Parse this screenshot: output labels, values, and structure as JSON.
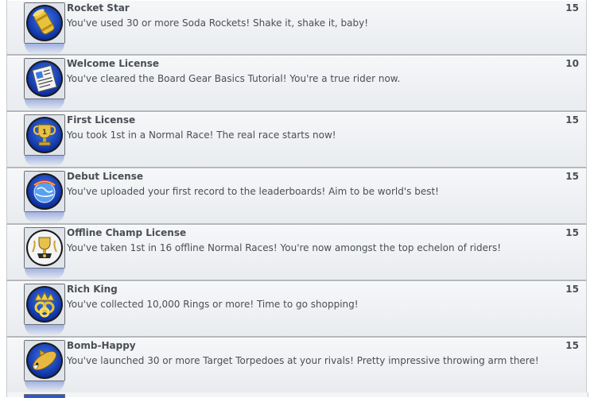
{
  "achievements": [
    {
      "title": "Rocket Star",
      "description": "You've used 30 or more Soda Rockets! Shake it, shake it, baby!",
      "points": "15",
      "icon": "soda-rocket-icon"
    },
    {
      "title": "Welcome License",
      "description": "You've cleared the Board Gear Basics Tutorial! You're a true rider now.",
      "points": "10",
      "icon": "license-document-icon"
    },
    {
      "title": "First License",
      "description": "You took 1st in a Normal Race! The real race starts now!",
      "points": "15",
      "icon": "trophy-icon"
    },
    {
      "title": "Debut License",
      "description": "You've uploaded your first record to the leaderboards! Aim to be world's best!",
      "points": "15",
      "icon": "globe-icon"
    },
    {
      "title": "Offline Champ License",
      "description": "You've taken 1st in 16 offline Normal Races! You're now amongst the top echelon of riders!",
      "points": "15",
      "icon": "champion-trophy-icon"
    },
    {
      "title": "Rich King",
      "description": "You've collected 10,000 Rings or more! Time to go shopping!",
      "points": "15",
      "icon": "crown-rings-icon"
    },
    {
      "title": "Bomb-Happy",
      "description": "You've launched 30 or more Target Torpedoes at your rivals! Pretty impressive throwing arm there!",
      "points": "15",
      "icon": "torpedo-shark-icon"
    }
  ]
}
